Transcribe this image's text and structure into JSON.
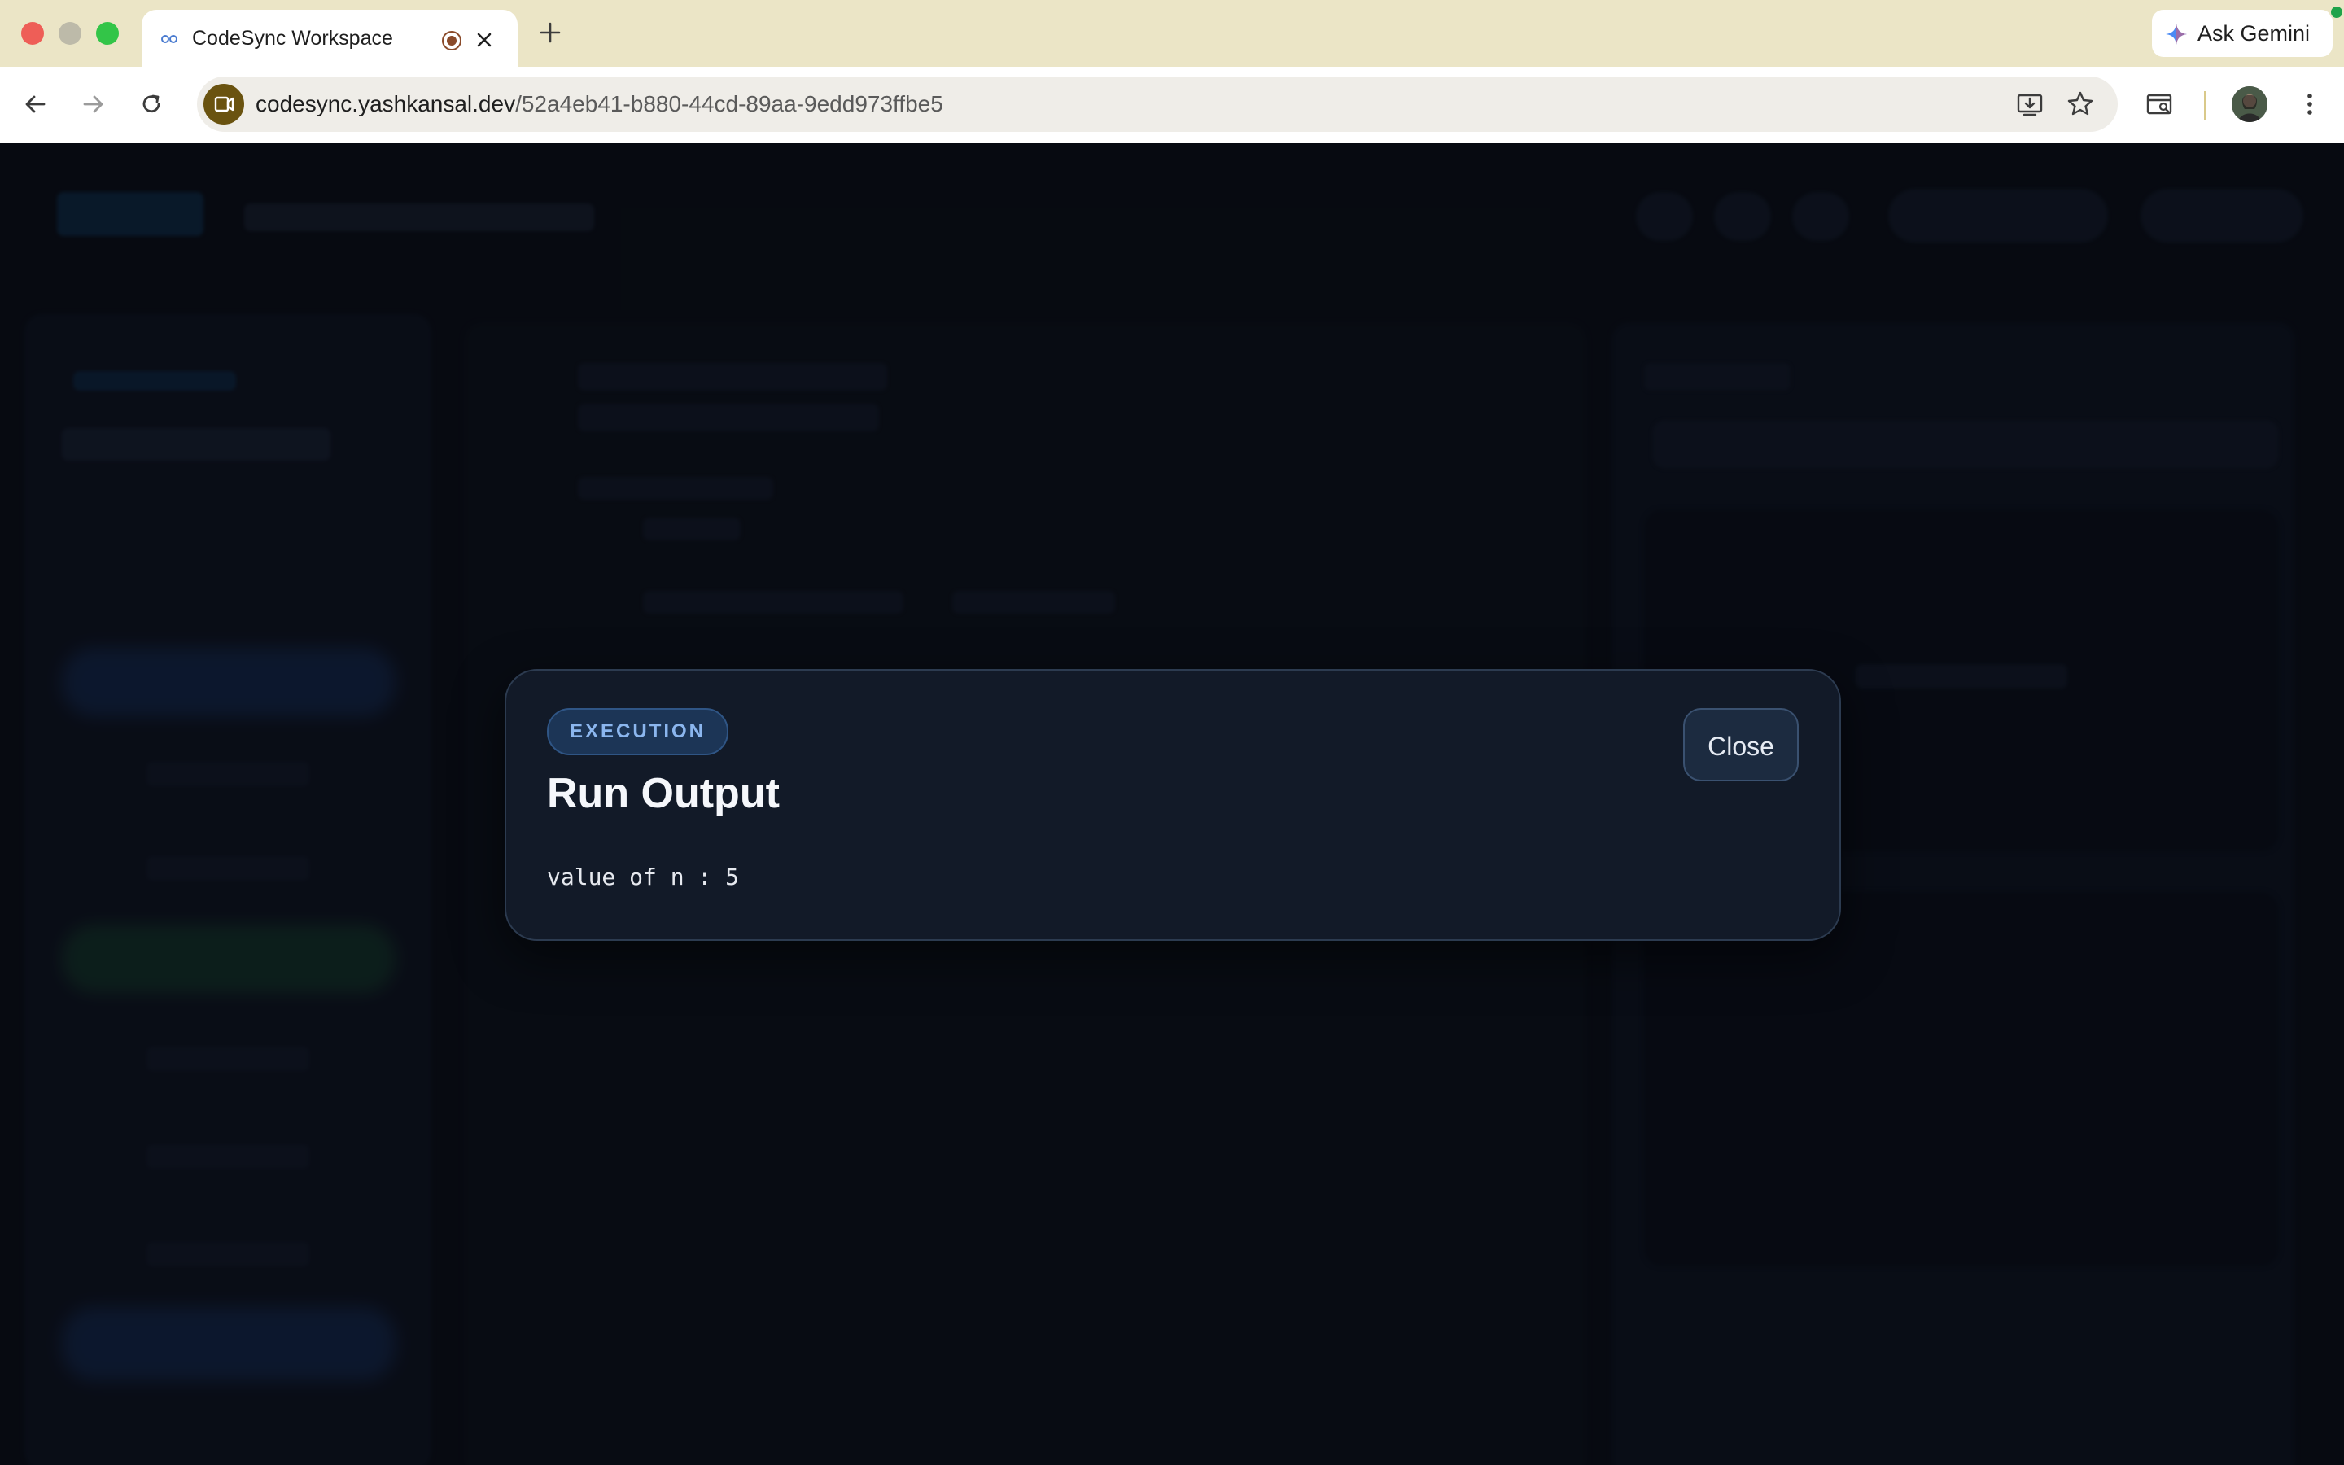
{
  "browser": {
    "tab_title": "CodeSync Workspace",
    "url_host": "codesync.yashkansal.dev",
    "url_path": "/52a4eb41-b880-44cd-89aa-9edd973ffbe5",
    "ask_gemini_label": "Ask Gemini"
  },
  "modal": {
    "badge": "EXECUTION",
    "title": "Run Output",
    "output": "value of n : 5",
    "close_label": "Close"
  },
  "colors": {
    "tabbar": "#ebe5c6",
    "modal_bg": "#121a28",
    "badge_text": "#8bb6ee",
    "app_bg": "#0a0e15"
  }
}
